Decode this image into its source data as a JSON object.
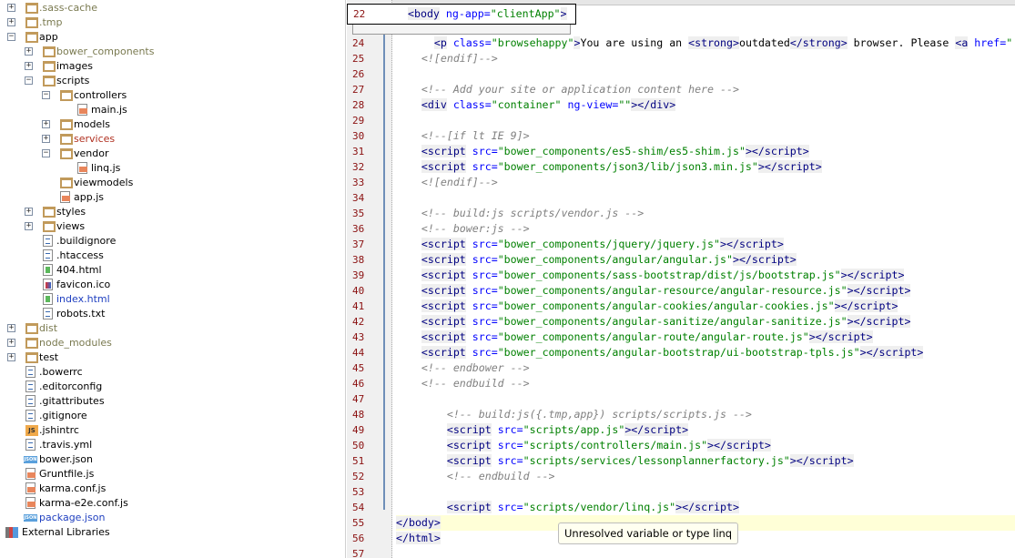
{
  "project_tree": [
    {
      "label": ".sass-cache",
      "depth": 0,
      "type": "folder",
      "toggle": "+",
      "color": "#7a7a50"
    },
    {
      "label": ".tmp",
      "depth": 0,
      "type": "folder",
      "toggle": "+",
      "color": "#7a7a50"
    },
    {
      "label": "app",
      "depth": 0,
      "type": "folder",
      "toggle": "-",
      "color": "#000000"
    },
    {
      "label": "bower_components",
      "depth": 1,
      "type": "folder",
      "toggle": "+",
      "color": "#7a7a50"
    },
    {
      "label": "images",
      "depth": 1,
      "type": "folder",
      "toggle": "+",
      "color": "#000000"
    },
    {
      "label": "scripts",
      "depth": 1,
      "type": "folder",
      "toggle": "-",
      "color": "#000000"
    },
    {
      "label": "controllers",
      "depth": 2,
      "type": "folder",
      "toggle": "-",
      "color": "#000000"
    },
    {
      "label": "main.js",
      "depth": 3,
      "type": "js",
      "color": "#000000"
    },
    {
      "label": "models",
      "depth": 2,
      "type": "folder",
      "toggle": "+",
      "color": "#000000"
    },
    {
      "label": "services",
      "depth": 2,
      "type": "folder",
      "toggle": "+",
      "color": "#b03020"
    },
    {
      "label": "vendor",
      "depth": 2,
      "type": "folder",
      "toggle": "-",
      "color": "#000000"
    },
    {
      "label": "linq.js",
      "depth": 3,
      "type": "js",
      "color": "#000000"
    },
    {
      "label": "viewmodels",
      "depth": 2,
      "type": "folder",
      "color": "#000000"
    },
    {
      "label": "app.js",
      "depth": 2,
      "type": "js",
      "color": "#000000"
    },
    {
      "label": "styles",
      "depth": 1,
      "type": "folder",
      "toggle": "+",
      "color": "#000000"
    },
    {
      "label": "views",
      "depth": 1,
      "type": "folder",
      "toggle": "+",
      "color": "#000000"
    },
    {
      "label": ".buildignore",
      "depth": 1,
      "type": "text",
      "color": "#000000"
    },
    {
      "label": ".htaccess",
      "depth": 1,
      "type": "text",
      "color": "#000000"
    },
    {
      "label": "404.html",
      "depth": 1,
      "type": "html",
      "color": "#000000"
    },
    {
      "label": "favicon.ico",
      "depth": 1,
      "type": "image",
      "color": "#000000"
    },
    {
      "label": "index.html",
      "depth": 1,
      "type": "html",
      "color": "#2040c0"
    },
    {
      "label": "robots.txt",
      "depth": 1,
      "type": "text",
      "color": "#000000"
    },
    {
      "label": "dist",
      "depth": 0,
      "type": "folder",
      "toggle": "+",
      "color": "#7a7a50"
    },
    {
      "label": "node_modules",
      "depth": 0,
      "type": "folder",
      "toggle": "+",
      "color": "#7a7a50"
    },
    {
      "label": "test",
      "depth": 0,
      "type": "folder",
      "toggle": "+",
      "color": "#000000"
    },
    {
      "label": ".bowerrc",
      "depth": 0,
      "type": "text",
      "color": "#000000"
    },
    {
      "label": ".editorconfig",
      "depth": 0,
      "type": "text",
      "color": "#000000"
    },
    {
      "label": ".gitattributes",
      "depth": 0,
      "type": "text",
      "color": "#000000"
    },
    {
      "label": ".gitignore",
      "depth": 0,
      "type": "text",
      "color": "#000000"
    },
    {
      "label": ".jshintrc",
      "depth": 0,
      "type": "jshint",
      "color": "#000000"
    },
    {
      "label": ".travis.yml",
      "depth": 0,
      "type": "yml",
      "color": "#000000"
    },
    {
      "label": "bower.json",
      "depth": 0,
      "type": "json",
      "color": "#000000"
    },
    {
      "label": "Gruntfile.js",
      "depth": 0,
      "type": "js",
      "color": "#000000"
    },
    {
      "label": "karma.conf.js",
      "depth": 0,
      "type": "js",
      "color": "#000000"
    },
    {
      "label": "karma-e2e.conf.js",
      "depth": 0,
      "type": "js",
      "color": "#000000"
    },
    {
      "label": "package.json",
      "depth": 0,
      "type": "json",
      "color": "#2040c0"
    },
    {
      "label": "External Libraries",
      "depth": -1,
      "type": "library",
      "color": "#000000"
    }
  ],
  "editor": {
    "sticky_line": {
      "number": "22",
      "text": "<body ng-app=\"clientApp\">"
    },
    "current_line": "55",
    "lines": [
      {
        "n": "24",
        "t": "      <p class=\"browsehappy\">You are using an <strong>outdated</strong> browser. Please <a href=\""
      },
      {
        "n": "25",
        "t": "    <![endif]-->"
      },
      {
        "n": "26",
        "t": ""
      },
      {
        "n": "27",
        "t": "    <!-- Add your site or application content here -->"
      },
      {
        "n": "28",
        "t": "    <div class=\"container\" ng-view=\"\"></div>"
      },
      {
        "n": "29",
        "t": ""
      },
      {
        "n": "30",
        "t": "    <!--[if lt IE 9]>"
      },
      {
        "n": "31",
        "t": "    <script src=\"bower_components/es5-shim/es5-shim.js\"></script>"
      },
      {
        "n": "32",
        "t": "    <script src=\"bower_components/json3/lib/json3.min.js\"></script>"
      },
      {
        "n": "33",
        "t": "    <![endif]-->"
      },
      {
        "n": "34",
        "t": ""
      },
      {
        "n": "35",
        "t": "    <!-- build:js scripts/vendor.js -->"
      },
      {
        "n": "36",
        "t": "    <!-- bower:js -->"
      },
      {
        "n": "37",
        "t": "    <script src=\"bower_components/jquery/jquery.js\"></script>"
      },
      {
        "n": "38",
        "t": "    <script src=\"bower_components/angular/angular.js\"></script>"
      },
      {
        "n": "39",
        "t": "    <script src=\"bower_components/sass-bootstrap/dist/js/bootstrap.js\"></script>"
      },
      {
        "n": "40",
        "t": "    <script src=\"bower_components/angular-resource/angular-resource.js\"></script>"
      },
      {
        "n": "41",
        "t": "    <script src=\"bower_components/angular-cookies/angular-cookies.js\"></script>"
      },
      {
        "n": "42",
        "t": "    <script src=\"bower_components/angular-sanitize/angular-sanitize.js\"></script>"
      },
      {
        "n": "43",
        "t": "    <script src=\"bower_components/angular-route/angular-route.js\"></script>"
      },
      {
        "n": "44",
        "t": "    <script src=\"bower_components/angular-bootstrap/ui-bootstrap-tpls.js\"></script>"
      },
      {
        "n": "45",
        "t": "    <!-- endbower -->"
      },
      {
        "n": "46",
        "t": "    <!-- endbuild -->"
      },
      {
        "n": "47",
        "t": ""
      },
      {
        "n": "48",
        "t": "        <!-- build:js({.tmp,app}) scripts/scripts.js -->"
      },
      {
        "n": "49",
        "t": "        <script src=\"scripts/app.js\"></script>"
      },
      {
        "n": "50",
        "t": "        <script src=\"scripts/controllers/main.js\"></script>"
      },
      {
        "n": "51",
        "t": "        <script src=\"scripts/services/lessonplannerfactory.js\"></script>"
      },
      {
        "n": "52",
        "t": "        <!-- endbuild -->"
      },
      {
        "n": "53",
        "t": ""
      },
      {
        "n": "54",
        "t": "        <script src=\"scripts/vendor/linq.js\"></script>"
      },
      {
        "n": "55",
        "t": "</body>"
      },
      {
        "n": "56",
        "t": "</html>"
      },
      {
        "n": "57",
        "t": ""
      }
    ],
    "tooltip": "Unresolved variable or type linq"
  }
}
